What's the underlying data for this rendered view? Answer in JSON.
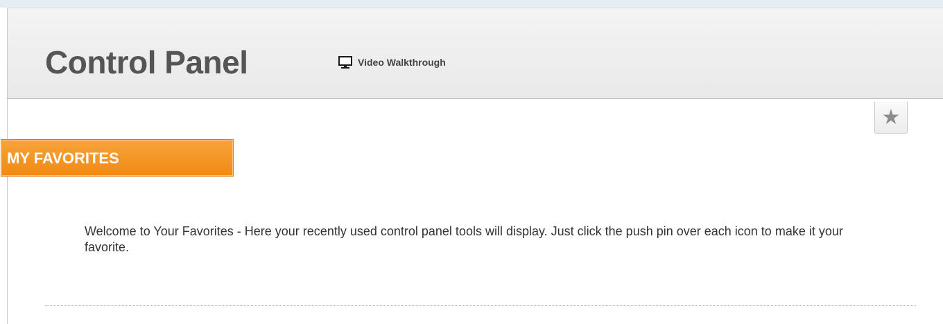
{
  "header": {
    "title": "Control Panel",
    "walkthrough_link": {
      "label": "Video Walkthrough",
      "icon": "monitor-icon"
    }
  },
  "favorites": {
    "tab_label": "MY FAVORITES",
    "welcome_text": "Welcome to Your Favorites - Here your recently used control panel tools will display. Just click the push pin over each icon to make it your favorite.",
    "favorite_button_icon": "star-icon"
  },
  "colors": {
    "accent_orange": "#f0901c",
    "title_gray": "#555555",
    "header_background": "#ececec"
  }
}
